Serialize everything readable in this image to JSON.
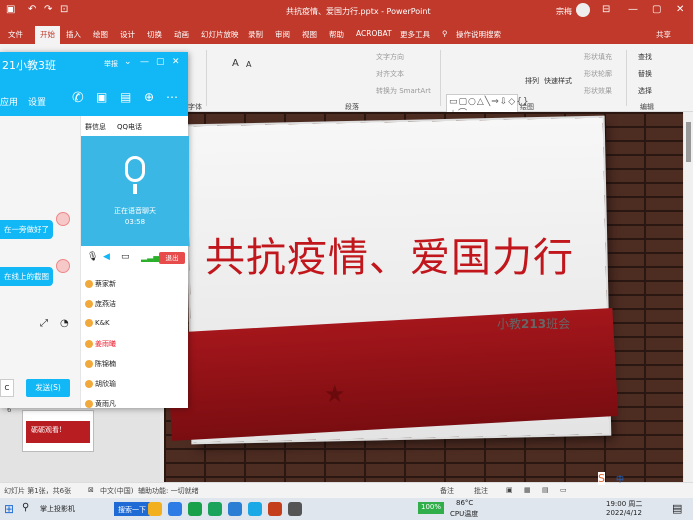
{
  "titlebar": {
    "doc_title": "共抗疫情、爱国力行.pptx - PowerPoint",
    "user": "宗梅",
    "qa_icons": [
      "save-icon",
      "undo-icon",
      "redo-icon",
      "present-icon"
    ]
  },
  "menu": {
    "items": [
      "文件",
      "开始",
      "插入",
      "绘图",
      "设计",
      "切换",
      "动画",
      "幻灯片放映",
      "录制",
      "审阅",
      "视图",
      "帮助",
      "ACROBAT",
      "更多工具"
    ],
    "active": "开始",
    "tell": "操作说明搜索",
    "share": "共享"
  },
  "ribbon": {
    "groups": {
      "font": "字体",
      "paragraph": "段落",
      "drawing": "绘图",
      "editing": "编辑"
    },
    "text_direction": "文字方向",
    "align_text": "对齐文本",
    "smartart": "转换为 SmartArt",
    "arrange": "排列",
    "quick_styles": "快速样式",
    "shape_fill": "形状填充",
    "shape_outline": "形状轮廓",
    "shape_effects": "形状效果",
    "find": "查找",
    "replace": "替换",
    "select": "选择",
    "font_size_up": "A",
    "font_size_down": "A"
  },
  "qq": {
    "title": "21小教3班",
    "title_right": "举报",
    "tabs": [
      "应用",
      "设置"
    ],
    "right_tabs": [
      "群信息",
      "QQ电话"
    ],
    "msg1": "在一旁做好了",
    "msg2": "在线上的截图",
    "voice_status": "正在语音聊天",
    "voice_time": "03:58",
    "exit": "退出",
    "send": "发送(S)",
    "close": "C",
    "members": [
      "蔡家新",
      "庞燕洁",
      "K&K",
      "姜雨曦",
      "陈锦楠",
      "胡欣瑜",
      "黄雨凡"
    ]
  },
  "slide": {
    "title": "共抗疫情、爱国力行",
    "subtitle_pre": "小教",
    "subtitle_num": "213",
    "subtitle_post": "班会",
    "thumb_num": "6",
    "thumb_text": "砺砺观看!"
  },
  "status": {
    "slide_info": "幻灯片 第1张，共6张",
    "lang": "中文(中国)",
    "access": "辅助功能: 一切就绪",
    "notes": "备注",
    "comments": "批注"
  },
  "taskbar": {
    "ime": "中",
    "weather_temp": "86°C",
    "weather": "CPU温度",
    "battery": "100%",
    "time": "19:00 周二",
    "date": "2022/4/12",
    "app1": "掌上投影机",
    "app2": "搜索一下"
  },
  "colors": {
    "accent": "#c0392b",
    "qq": "#12b7f5",
    "slide_red": "#c0161c"
  }
}
